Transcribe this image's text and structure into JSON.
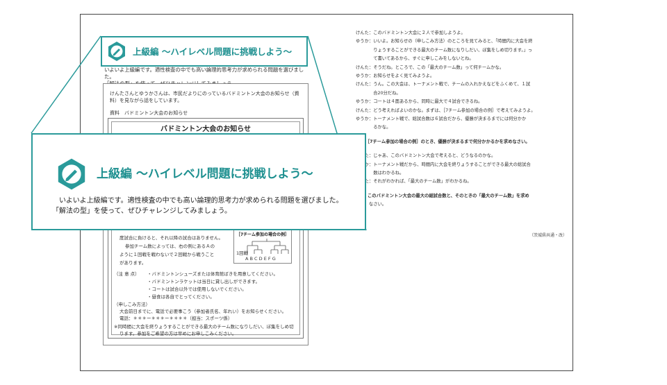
{
  "left_page": {
    "title": "上級編 〜ハイレベル問題に挑戦しよう〜",
    "intro_line1": "いよいよ上級編です。適性検査の中でも高い論理的思考力が求められる問題を選びました。",
    "intro_line2": "「解法の型」を使って、ぜひチャレンジしてみましょう。",
    "story_line1": "けんたさんとゆうかさんは、市民だよりにのっているバドミントン大会のお知らせ（資",
    "story_line2": "料）を見ながら話をしています。",
    "source_label": "資料　バドミントン大会のお知らせ",
    "notice": {
      "title": "バドミントン大会のお知らせ",
      "body_line1": "度試合に負けると、それ以降の試合はありません。",
      "body_line2": "参加チーム数によっては、右の例にあるＡの",
      "body_line3": "ように１回戦を戦わないで２回戦から戦うこと",
      "body_line4": "があります。",
      "example_title": "［7チーム参加の場合の例］",
      "example_round": "1回戦",
      "example_teams": "A  B C D E F G",
      "notes_label": "（注 意 点）",
      "notes": [
        "・バドミントンシューズまたは体育館ばきを用意してください。",
        "・バドミントンラケットは当日に貸し出しができます。",
        "・コートは試合以外では使用しないでください。",
        "・昼食は各自でとってください。"
      ],
      "apply_label": "（申しこみ方法）",
      "apply_line1": "大会前日までに、電話で必要事こう（参加者氏名、年れい）をお知らせください。",
      "apply_line2": "電話：＊＊＊ー＊＊＊ー＊＊＊＊（担当：スポーツ係）",
      "footnote_line1": "※同時間に大会を終りょうすることができる最大のチーム数になりしだい、ぼ集をしめ切",
      "footnote_line2": "ります。参加をご希望の方は早めにお申しこみください。"
    }
  },
  "right_page": {
    "lines": [
      "けんた：このバドミントン大会に２人で参加しようよ。",
      "ゆうか：いいよ。お知らせの（申しこみ方法）のところを見てみると、「時間内に大会を終",
      "　　　　りょうすることができる最大のチーム数になりしだい、ぼ集をしめ切ります。」っ",
      "　　　　て書いてあるから、すぐに申しこみをしないとね。",
      "けんた：そうだね。ところで、この「最大のチーム数」って何チームかな。",
      "ゆうか：お知らせをよく見てみようよ。",
      "けんた：うん。この大会は、トーナメント戦で、チームの入れかえなどをふくめて、１試",
      "　　　　合20分だね。",
      "ゆうか：コートは４面あるから、同時に最大で４試合できるね。",
      "けんた：どう考えればよいのかな。まずは、［7チーム参加の場合の例］で考えてみようよ。",
      "ゆうか：トーナメント戦で、総試合数は６試合だから、優勝が決まるまでには何分かか",
      "　　　　るかな。",
      "",
      "問1　［7チーム参加の場合の例］のとき、優勝が決まるまで何分かかるかを求めなさい。",
      "",
      "けんた：じゃあ、このバドミントン大会で考えると、どうなるのかな。",
      "ゆうか：トーナメント戦だから、時間内に大会を終りょうすることができる最大の総試合",
      "　　　　数はわかるね。",
      "けんた：それがわかれば、「最大のチーム数」がわかるね。",
      "",
      "問2　このバドミントン大会の最大の総試合数と、そのときの「最大のチーム数」を求め",
      "　　　なさい。"
    ],
    "credit": "（茨城県共通・改）"
  },
  "callout": {
    "title": "上級編 〜ハイレベル問題に挑戦しよう〜",
    "text_line1": "いよいよ上級編です。適性検査の中でも高い論理的思考力が求められる問題を選びました。",
    "text_line2": "「解法の型」を使って、ぜひチャレンジしてみましょう。"
  },
  "colors": {
    "accent": "#2a9a9a",
    "accent_text": "#1e9090"
  },
  "icons": [
    "pencil-badge-icon"
  ]
}
